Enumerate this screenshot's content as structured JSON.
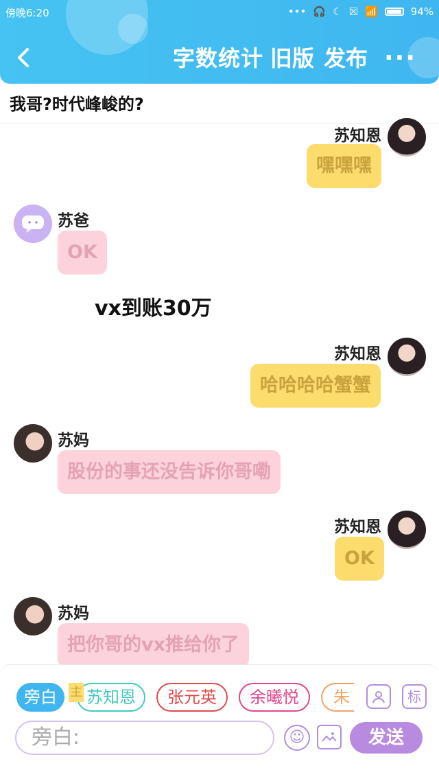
{
  "status_bar": {
    "time": "傍晚6:20",
    "battery": "94%"
  },
  "header": {
    "title": "字数统计",
    "old_version": "旧版",
    "publish": "发布",
    "more": "···"
  },
  "document": {
    "title": "我哥?时代峰峻的?"
  },
  "messages": [
    {
      "side": "right",
      "speaker": "苏知恩",
      "text": "嘿嘿嘿",
      "color": "yellow"
    },
    {
      "side": "left",
      "speaker": "苏爸",
      "text": "OK",
      "color": "pink"
    },
    {
      "side": "narration",
      "text": "vx到账30万"
    },
    {
      "side": "right",
      "speaker": "苏知恩",
      "text": "哈哈哈哈蟹蟹",
      "color": "yellow"
    },
    {
      "side": "left",
      "speaker": "苏妈",
      "text": "股份的事还没告诉你哥嘞",
      "color": "pink"
    },
    {
      "side": "right",
      "speaker": "苏知恩",
      "text": "OK",
      "color": "yellow"
    },
    {
      "side": "left",
      "speaker": "苏妈",
      "text": "把你哥的vx推给你了",
      "color": "pink"
    }
  ],
  "composer": {
    "chips": [
      "旁白",
      "苏知恩",
      "张元英",
      "余曦悦",
      "朱玥"
    ],
    "main_tag": "主",
    "tool_label": "标",
    "input_placeholder": "旁白:",
    "send_label": "发送"
  },
  "colors": {
    "header": "#3fb6f0",
    "yellow_bubble": "#fddc6e",
    "pink_bubble": "#fcd2dc",
    "send_button": "#b98be0"
  }
}
